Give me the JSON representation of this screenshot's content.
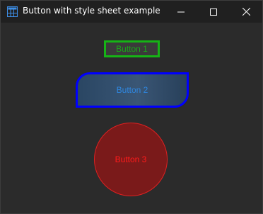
{
  "window": {
    "title": "Button with style sheet example",
    "app_icon": "window-grid-icon",
    "controls": {
      "minimize_icon": "minimize-icon",
      "maximize_icon": "maximize-icon",
      "close_icon": "close-icon"
    }
  },
  "buttons": [
    {
      "label": "Button 1",
      "border_color": "#16b316",
      "text_color": "#18a818"
    },
    {
      "label": "Button 2",
      "border_color": "#0000ff",
      "text_color": "#2f87e0"
    },
    {
      "label": "Button 3",
      "border_color": "#e02020",
      "text_color": "#ff1a1a"
    }
  ]
}
